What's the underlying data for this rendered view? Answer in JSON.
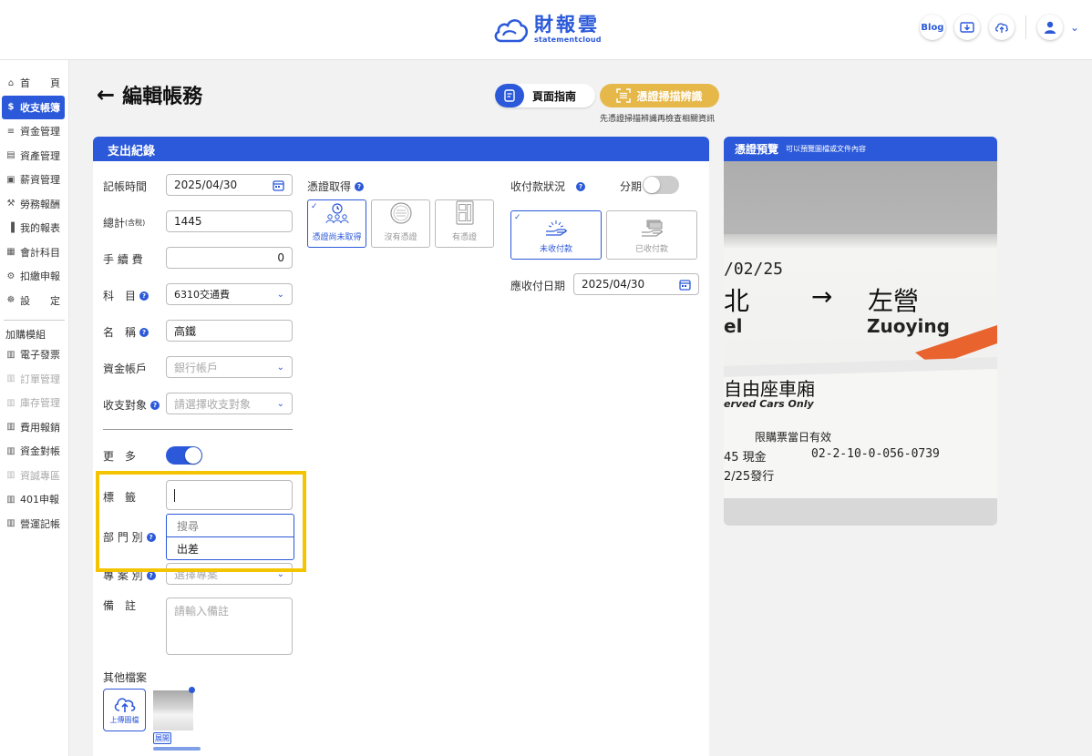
{
  "brand": {
    "title": "財報雲",
    "subtitle": "statementcloud",
    "color": "#2b59d9"
  },
  "topbar": {
    "blog_label": "Blog",
    "icons": [
      "blog-icon",
      "import-icon",
      "upload-cloud-icon",
      "user-icon",
      "chevron-down-icon"
    ]
  },
  "sidebar": {
    "items": [
      {
        "label": "首　　頁",
        "icon": "home-icon",
        "active": false,
        "disabled": false
      },
      {
        "label": "收支帳簿",
        "icon": "dollar-icon",
        "active": true,
        "disabled": false
      },
      {
        "label": "資金管理",
        "icon": "money-icon",
        "active": false,
        "disabled": false
      },
      {
        "label": "資產管理",
        "icon": "building-icon",
        "active": false,
        "disabled": false
      },
      {
        "label": "薪資管理",
        "icon": "wallet-icon",
        "active": false,
        "disabled": false
      },
      {
        "label": "勞務報酬",
        "icon": "labor-icon",
        "active": false,
        "disabled": false
      },
      {
        "label": "我的報表",
        "icon": "chart-icon",
        "active": false,
        "disabled": false
      },
      {
        "label": "會計科目",
        "icon": "ledger-icon",
        "active": false,
        "disabled": false
      },
      {
        "label": "扣繳申報",
        "icon": "tax-icon",
        "active": false,
        "disabled": false
      },
      {
        "label": "設　　定",
        "icon": "settings-icon",
        "active": false,
        "disabled": false
      }
    ],
    "addon_heading": "加購模組",
    "addons": [
      {
        "label": "電子發票",
        "disabled": false
      },
      {
        "label": "訂單管理",
        "disabled": true
      },
      {
        "label": "庫存管理",
        "disabled": true
      },
      {
        "label": "費用報銷",
        "disabled": false
      },
      {
        "label": "資金對帳",
        "disabled": false
      },
      {
        "label": "資誠專區",
        "disabled": true
      },
      {
        "label": "401申報",
        "disabled": false
      },
      {
        "label": "營運記帳",
        "disabled": false
      }
    ]
  },
  "page": {
    "title": "編輯帳務",
    "guide_label": "頁面指南",
    "scan_label": "憑證掃描辨識",
    "scan_hint": "先憑證掃描辨識再檢查相關資訊"
  },
  "form": {
    "tab": "支出紀錄",
    "date_label": "記帳時間",
    "date_value": "2025/04/30",
    "total_label": "總計",
    "total_suffix": "(含稅)",
    "total_value": "1445",
    "fee_label": "手 續 費",
    "fee_value": "0",
    "account_label": "科　目",
    "account_value": "6310交通費",
    "name_label": "名　稱",
    "name_value": "高鐵",
    "fund_label": "資金帳戶",
    "fund_placeholder": "銀行帳戶",
    "party_label": "收支對象",
    "party_placeholder": "請選擇收支對象",
    "more_label": "更　多",
    "more_on": true,
    "tag_label": "標　籤",
    "dept_label": "部 門 別",
    "project_label": "專 案 別",
    "project_placeholder": "選擇專案",
    "note_label": "備　註",
    "note_placeholder": "請輸入備註",
    "files_label": "其他檔案",
    "upload_label": "上傳圖檔",
    "expand_label": "展開",
    "dropdown": {
      "search_placeholder": "搜尋",
      "options": [
        "出差"
      ]
    }
  },
  "evidence": {
    "label": "憑證取得",
    "options": [
      {
        "label": "憑證尚未取得",
        "selected": true
      },
      {
        "label": "沒有憑證",
        "selected": false
      },
      {
        "label": "有憑證",
        "selected": false
      }
    ]
  },
  "payment": {
    "label": "收付款狀況",
    "installment_label": "分期",
    "installment_on": false,
    "options": [
      {
        "label": "未收付款",
        "selected": true
      },
      {
        "label": "已收付款",
        "selected": false
      }
    ],
    "due_label": "應收付日期",
    "due_value": "2025/04/30"
  },
  "preview": {
    "title": "憑證預覽",
    "subtitle": "可以預覽圖檔或文件內容",
    "ticket": {
      "date": "/02/25",
      "from_cn": "北",
      "to_cn": "左營",
      "from_en": "el",
      "to_en": "Zuoying",
      "car_cn": "自由座車廂",
      "car_en": "erved Cars Only",
      "valid": "限購票當日有效",
      "price": "45 現金",
      "code": "02-2-10-0-056-0739",
      "issued": "2/25發行"
    }
  }
}
